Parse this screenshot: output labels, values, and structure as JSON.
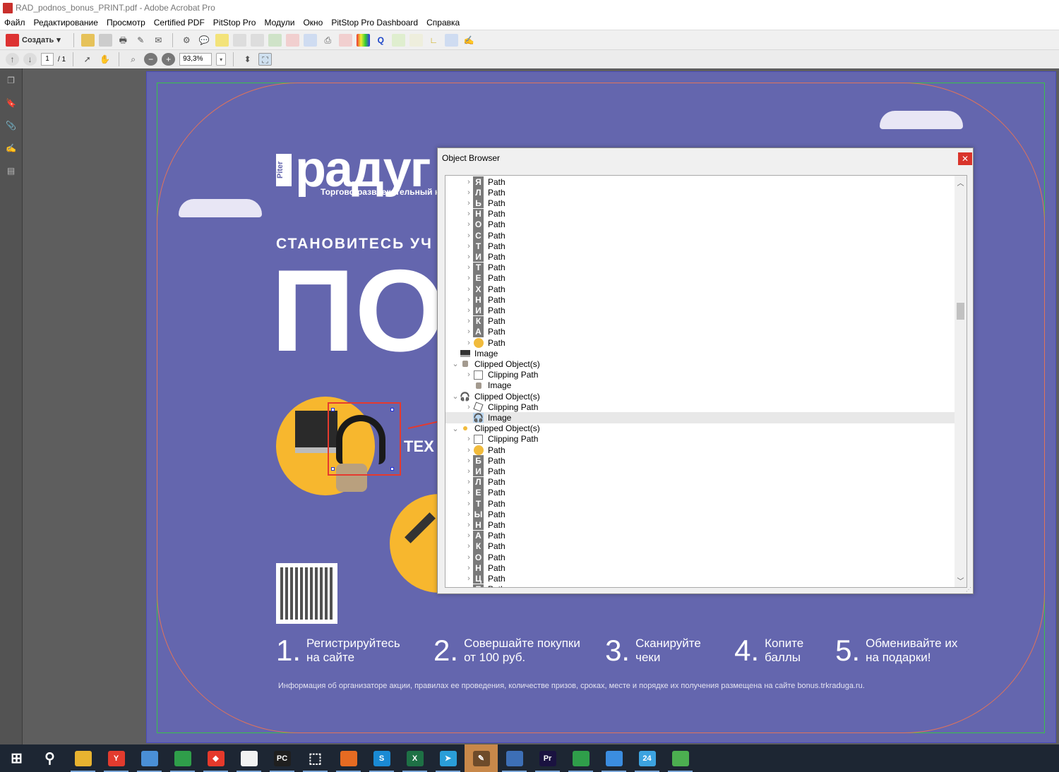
{
  "window": {
    "title": "RAD_podnos_bonus_PRINT.pdf - Adobe Acrobat Pro"
  },
  "menu": [
    "Файл",
    "Редактирование",
    "Просмотр",
    "Certified PDF",
    "PitStop Pro",
    "Модули",
    "Окно",
    "PitStop Pro Dashboard",
    "Справка"
  ],
  "toolbar": {
    "create_label": "Создать",
    "page_current": "1",
    "page_total": "/ 1",
    "zoom": "93,3%"
  },
  "document": {
    "logo_text": "радуг",
    "logo_badge": "Piter",
    "subtitle": "Торгово-развлекательный ко",
    "headline": "СТАНОВИТЕСЬ УЧ",
    "big_text": "ПО",
    "category_text": "ТЕХ",
    "steps": [
      {
        "num": "1.",
        "text": "Регистрируйтесь на сайте"
      },
      {
        "num": "2.",
        "text": "Совершайте покупки от 100 руб."
      },
      {
        "num": "3.",
        "text": "Сканируйте чеки"
      },
      {
        "num": "4.",
        "text": "Копите баллы"
      },
      {
        "num": "5.",
        "text": "Обменивайте их на подарки!"
      }
    ],
    "footnote": "Информация об организаторе акции, правилах ее проведения, количестве призов, сроках, месте и порядке их получения размещена на сайте bonus.trkraduga.ru.",
    "colors": {
      "background": "#6466ae",
      "accent": "#f7b72e"
    }
  },
  "object_browser": {
    "title": "Object Browser",
    "close": "✕",
    "rows": [
      {
        "label": "Path",
        "level": 1,
        "exp": "c",
        "icon": "letter",
        "glyph": "Я"
      },
      {
        "label": "Path",
        "level": 1,
        "exp": "c",
        "icon": "letter",
        "glyph": "Л"
      },
      {
        "label": "Path",
        "level": 1,
        "exp": "c",
        "icon": "letter",
        "glyph": "Ь"
      },
      {
        "label": "Path",
        "level": 1,
        "exp": "c",
        "icon": "letter",
        "glyph": "Н"
      },
      {
        "label": "Path",
        "level": 1,
        "exp": "c",
        "icon": "letter",
        "glyph": "О"
      },
      {
        "label": "Path",
        "level": 1,
        "exp": "c",
        "icon": "letter",
        "glyph": "С"
      },
      {
        "label": "Path",
        "level": 1,
        "exp": "c",
        "icon": "letter",
        "glyph": "Т"
      },
      {
        "label": "Path",
        "level": 1,
        "exp": "c",
        "icon": "letter",
        "glyph": "И"
      },
      {
        "label": "Path",
        "level": 1,
        "exp": "c",
        "icon": "letter",
        "glyph": "Т"
      },
      {
        "label": "Path",
        "level": 1,
        "exp": "c",
        "icon": "letter",
        "glyph": "Е"
      },
      {
        "label": "Path",
        "level": 1,
        "exp": "c",
        "icon": "letter",
        "glyph": "Х"
      },
      {
        "label": "Path",
        "level": 1,
        "exp": "c",
        "icon": "letter",
        "glyph": "Н"
      },
      {
        "label": "Path",
        "level": 1,
        "exp": "c",
        "icon": "letter",
        "glyph": "И"
      },
      {
        "label": "Path",
        "level": 1,
        "exp": "c",
        "icon": "letter",
        "glyph": "К"
      },
      {
        "label": "Path",
        "level": 1,
        "exp": "c",
        "icon": "letter",
        "glyph": "А"
      },
      {
        "label": "Path",
        "level": 1,
        "exp": "c",
        "icon": "dot",
        "glyph": ""
      },
      {
        "label": "Image",
        "level": 0,
        "exp": "",
        "icon": "laptop",
        "glyph": ""
      },
      {
        "label": "Clipped Object(s)",
        "level": 0,
        "exp": "e",
        "icon": "cube",
        "glyph": ""
      },
      {
        "label": "Clipping Path",
        "level": 1,
        "exp": "c",
        "icon": "box",
        "glyph": ""
      },
      {
        "label": "Image",
        "level": 1,
        "exp": "",
        "icon": "cube",
        "glyph": ""
      },
      {
        "label": "Clipped Object(s)",
        "level": 0,
        "exp": "e",
        "icon": "head",
        "glyph": "🎧"
      },
      {
        "label": "Clipping Path",
        "level": 1,
        "exp": "c",
        "icon": "boxrot",
        "glyph": ""
      },
      {
        "label": "Image",
        "level": 1,
        "exp": "",
        "icon": "head hl",
        "glyph": "🎧",
        "selected": true
      },
      {
        "label": "Clipped Object(s)",
        "level": 0,
        "exp": "e",
        "icon": "small-dot",
        "glyph": ""
      },
      {
        "label": "Clipping Path",
        "level": 1,
        "exp": "c",
        "icon": "box",
        "glyph": ""
      },
      {
        "label": "Path",
        "level": 1,
        "exp": "c",
        "icon": "dot",
        "glyph": ""
      },
      {
        "label": "Path",
        "level": 1,
        "exp": "c",
        "icon": "letter",
        "glyph": "Б"
      },
      {
        "label": "Path",
        "level": 1,
        "exp": "c",
        "icon": "letter",
        "glyph": "И"
      },
      {
        "label": "Path",
        "level": 1,
        "exp": "c",
        "icon": "letter",
        "glyph": "Л"
      },
      {
        "label": "Path",
        "level": 1,
        "exp": "c",
        "icon": "letter",
        "glyph": "Е"
      },
      {
        "label": "Path",
        "level": 1,
        "exp": "c",
        "icon": "letter",
        "glyph": "Т"
      },
      {
        "label": "Path",
        "level": 1,
        "exp": "c",
        "icon": "letter",
        "glyph": "Ы"
      },
      {
        "label": "Path",
        "level": 1,
        "exp": "c",
        "icon": "letter",
        "glyph": "Н"
      },
      {
        "label": "Path",
        "level": 1,
        "exp": "c",
        "icon": "letter",
        "glyph": "А"
      },
      {
        "label": "Path",
        "level": 1,
        "exp": "c",
        "icon": "letter",
        "glyph": "К"
      },
      {
        "label": "Path",
        "level": 1,
        "exp": "c",
        "icon": "letter",
        "glyph": "О"
      },
      {
        "label": "Path",
        "level": 1,
        "exp": "c",
        "icon": "letter",
        "glyph": "Н"
      },
      {
        "label": "Path",
        "level": 1,
        "exp": "c",
        "icon": "letter",
        "glyph": "Ц"
      },
      {
        "label": "Path",
        "level": 1,
        "exp": "c",
        "icon": "letter",
        "glyph": "Е"
      }
    ]
  },
  "taskbar": [
    {
      "name": "start",
      "glyph": "⊞",
      "color": "transparent"
    },
    {
      "name": "search",
      "glyph": "⚲",
      "color": "transparent"
    },
    {
      "name": "file-explorer",
      "glyph": "",
      "color": "#e8b330"
    },
    {
      "name": "yandex-browser",
      "glyph": "Y",
      "color": "#e23b2e"
    },
    {
      "name": "app-window",
      "glyph": "",
      "color": "#4a8fd6"
    },
    {
      "name": "chrome",
      "glyph": "",
      "color": "#2f9e4a"
    },
    {
      "name": "anydesk",
      "glyph": "◆",
      "color": "#e5392b"
    },
    {
      "name": "acrobat",
      "glyph": "",
      "color": "#f2f2f2"
    },
    {
      "name": "pycharm",
      "glyph": "PC",
      "color": "#1f1f1f"
    },
    {
      "name": "snipping-tool",
      "glyph": "⬚",
      "color": "transparent"
    },
    {
      "name": "firefox",
      "glyph": "",
      "color": "#e66b22"
    },
    {
      "name": "skype",
      "glyph": "S",
      "color": "#1a8ad4"
    },
    {
      "name": "excel",
      "glyph": "X",
      "color": "#1e7145"
    },
    {
      "name": "telegram",
      "glyph": "➤",
      "color": "#2a9ed8"
    },
    {
      "name": "pen-app",
      "glyph": "✎",
      "color": "#6e4b2a"
    },
    {
      "name": "remote-desktop",
      "glyph": "",
      "color": "#3d6fb6"
    },
    {
      "name": "premiere",
      "glyph": "Pr",
      "color": "#1a1240"
    },
    {
      "name": "chrome-2",
      "glyph": "",
      "color": "#2f9e4a"
    },
    {
      "name": "app-swoosh",
      "glyph": "",
      "color": "#3b8de0"
    },
    {
      "name": "clock-24",
      "glyph": "24",
      "color": "#3ca3e0"
    },
    {
      "name": "green-app",
      "glyph": "",
      "color": "#4caf50"
    }
  ]
}
